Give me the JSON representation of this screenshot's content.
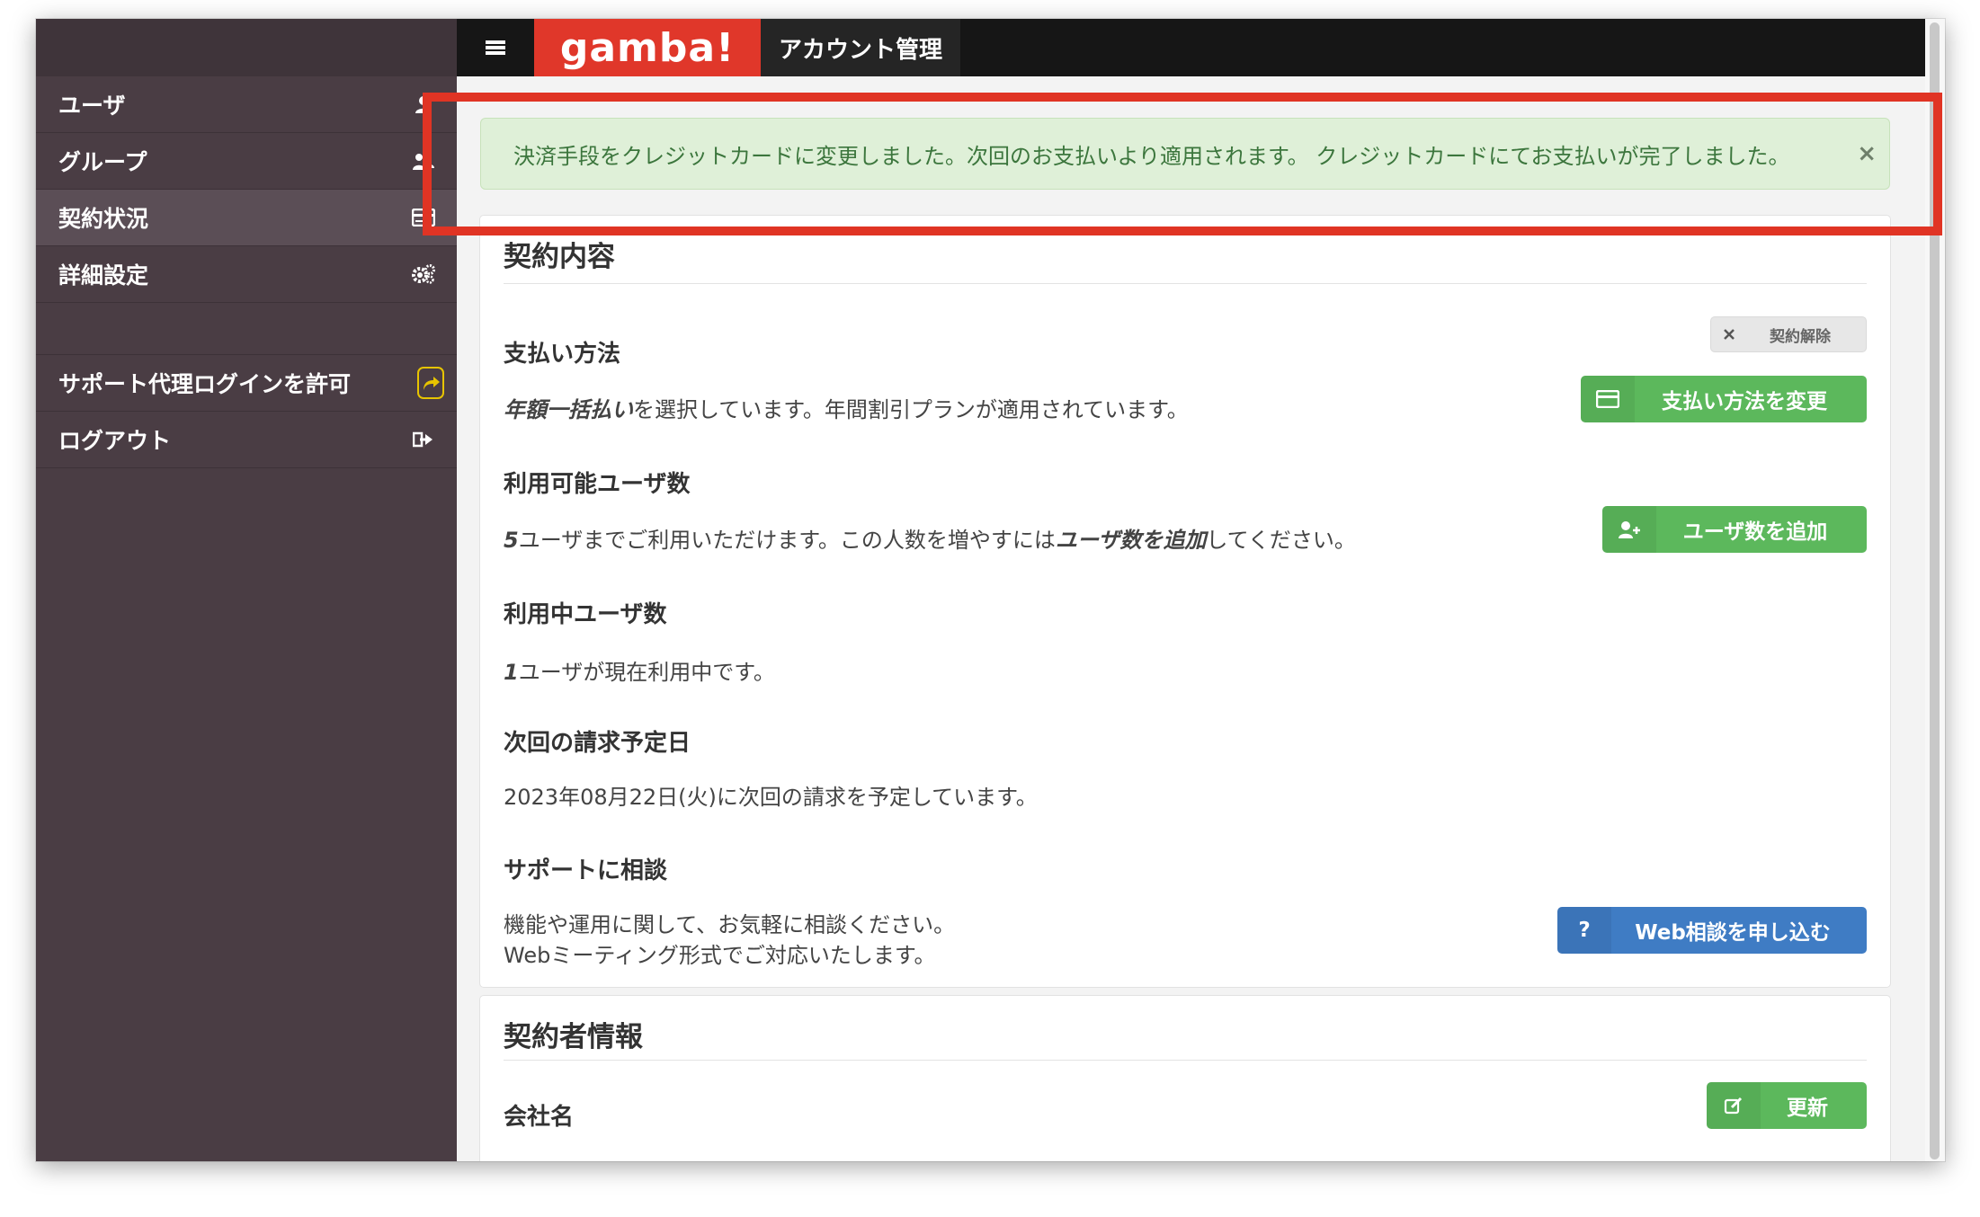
{
  "sidebar": {
    "items": [
      {
        "label": "ユーザ",
        "icon": "user-icon"
      },
      {
        "label": "グループ",
        "icon": "users-icon"
      },
      {
        "label": "契約状況",
        "icon": "card-icon"
      },
      {
        "label": "詳細設定",
        "icon": "cogs-icon"
      },
      {
        "label": "サポート代理ログインを許可",
        "icon": "share-icon"
      },
      {
        "label": "ログアウト",
        "icon": "sign-out-icon"
      }
    ],
    "active_item": "契約状況"
  },
  "topbar": {
    "brand": "gamba!",
    "page_title": "アカウント管理"
  },
  "alert": {
    "message": "決済手段をクレジットカードに変更しました。次回のお支払いより適用されます。 クレジットカードにてお支払いが完了しました。",
    "close": "×"
  },
  "contract": {
    "title": "契約内容",
    "cancel_label": "契約解除",
    "payment": {
      "label": "支払い方法",
      "emphasis": "年額一括払い",
      "text": "を選択しています。年間割引プランが適用されています。",
      "button": "支払い方法を変更"
    },
    "available_users": {
      "label": "利用可能ユーザ数",
      "count": "5",
      "text_before": "ユーザまでご利用いただけます。この人数を増やすには",
      "emphasis": "ユーザ数を追加",
      "text_after": "してください。",
      "button": "ユーザ数を追加"
    },
    "active_users": {
      "label": "利用中ユーザ数",
      "count": "1",
      "text": "ユーザが現在利用中です。"
    },
    "next_billing": {
      "label": "次回の請求予定日",
      "text": "2023年08月22日(火)に次回の請求を予定しています。"
    },
    "support": {
      "label": "サポートに相談",
      "line1": "機能や運用に関して、お気軽に相談ください。",
      "line2": "Webミーティング形式でご対応いたします。",
      "button": "Web相談を申し込む",
      "button_icon": "?"
    }
  },
  "contractor": {
    "title": "契約者情報",
    "company_label": "会社名",
    "update_button": "更新"
  },
  "colors": {
    "sidebar_bg": "#4a3d44",
    "brand_red": "#e0372a",
    "success_bg": "#dff0d8",
    "success_text": "#3c763d",
    "button_green": "#5cb85c",
    "button_blue": "#3f7cc4",
    "highlight_red": "#e03424"
  }
}
